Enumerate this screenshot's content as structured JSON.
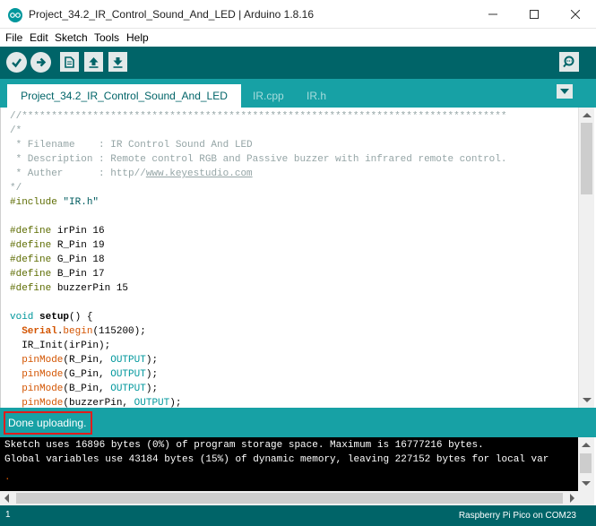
{
  "window": {
    "title": "Project_34.2_IR_Control_Sound_And_LED | Arduino 1.8.16"
  },
  "menu": [
    "File",
    "Edit",
    "Sketch",
    "Tools",
    "Help"
  ],
  "toolbar": {
    "verify_icon": "check-icon",
    "upload_icon": "arrow-right-icon",
    "new_icon": "new-file-icon",
    "open_icon": "arrow-up-icon",
    "save_icon": "arrow-down-icon",
    "serial_icon": "magnifier-icon"
  },
  "tabs": [
    {
      "label": "Project_34.2_IR_Control_Sound_And_LED",
      "active": true
    },
    {
      "label": "IR.cpp",
      "active": false
    },
    {
      "label": "IR.h",
      "active": false
    }
  ],
  "code": {
    "lines": [
      "//**********************************************************************************",
      "/*",
      " * Filename    : IR Control Sound And LED",
      " * Description : Remote control RGB and Passive buzzer with infrared remote control.",
      " * Auther      : http//www.keyestudio.com",
      "*/",
      "#include \"IR.h\"",
      "",
      "#define irPin 16",
      "#define R_Pin 19",
      "#define G_Pin 18",
      "#define B_Pin 17",
      "#define buzzerPin 15",
      "",
      "void setup() {",
      "  Serial.begin(115200);",
      "  IR_Init(irPin);",
      "  pinMode(R_Pin, OUTPUT);",
      "  pinMode(G_Pin, OUTPUT);",
      "  pinMode(B_Pin, OUTPUT);",
      "  pinMode(buzzerPin, OUTPUT);"
    ]
  },
  "status": {
    "message": "Done uploading."
  },
  "console": {
    "lines": [
      "Sketch uses 16896 bytes (0%) of program storage space. Maximum is 16777216 bytes.",
      "Global variables use 43184 bytes (15%) of dynamic memory, leaving 227152 bytes for local var"
    ]
  },
  "footer": {
    "line_number": "1",
    "board": "Raspberry Pi Pico on COM23"
  },
  "colors": {
    "toolbar_bg": "#006468",
    "tab_bar_bg": "#17a1a5",
    "status_highlight": "#e11b1b"
  }
}
